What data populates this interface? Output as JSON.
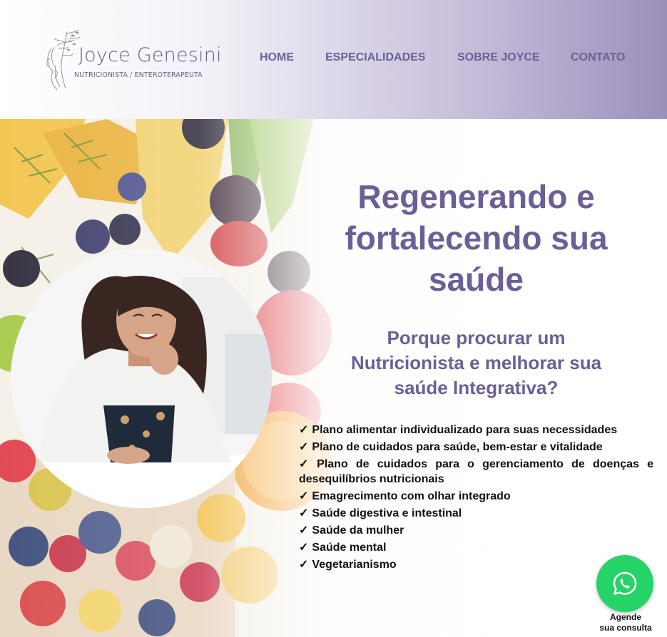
{
  "header": {
    "logo": {
      "name": "Joyce Genesini",
      "subtitle": "NUTRICIONISTA / ENTEROTERAPEUTA"
    },
    "nav": [
      {
        "label": "HOME"
      },
      {
        "label": "ESPECIALIDADES"
      },
      {
        "label": "SOBRE JOYCE"
      },
      {
        "label": "CONTATO"
      }
    ]
  },
  "hero": {
    "title_lines": [
      "Regenerando e",
      "fortalecendo sua",
      "saúde"
    ],
    "subtitle_lines": [
      "Porque procurar um",
      "Nutricionista e melhorar sua",
      "saúde Integrativa?"
    ],
    "check_symbol": "✓",
    "bullets": [
      "Plano alimentar individualizado para suas necessidades",
      "Plano de cuidados para saúde, bem-estar e vitalidade",
      "Plano de cuidados para o gerenciamento de doenças e desequilíbrios nutricionais",
      "Emagrecimento com olhar integrado",
      "Saúde digestiva e intestinal",
      "Saúde da mulher",
      "Saúde mental",
      "Vegetarianismo"
    ]
  },
  "whatsapp": {
    "icon": "whatsapp-icon",
    "label_lines": [
      "Agende",
      "sua consulta"
    ]
  },
  "colors": {
    "brand": "#6c5f97",
    "header_gradient_end": "#9c90bb",
    "whatsapp": "#25d366"
  }
}
